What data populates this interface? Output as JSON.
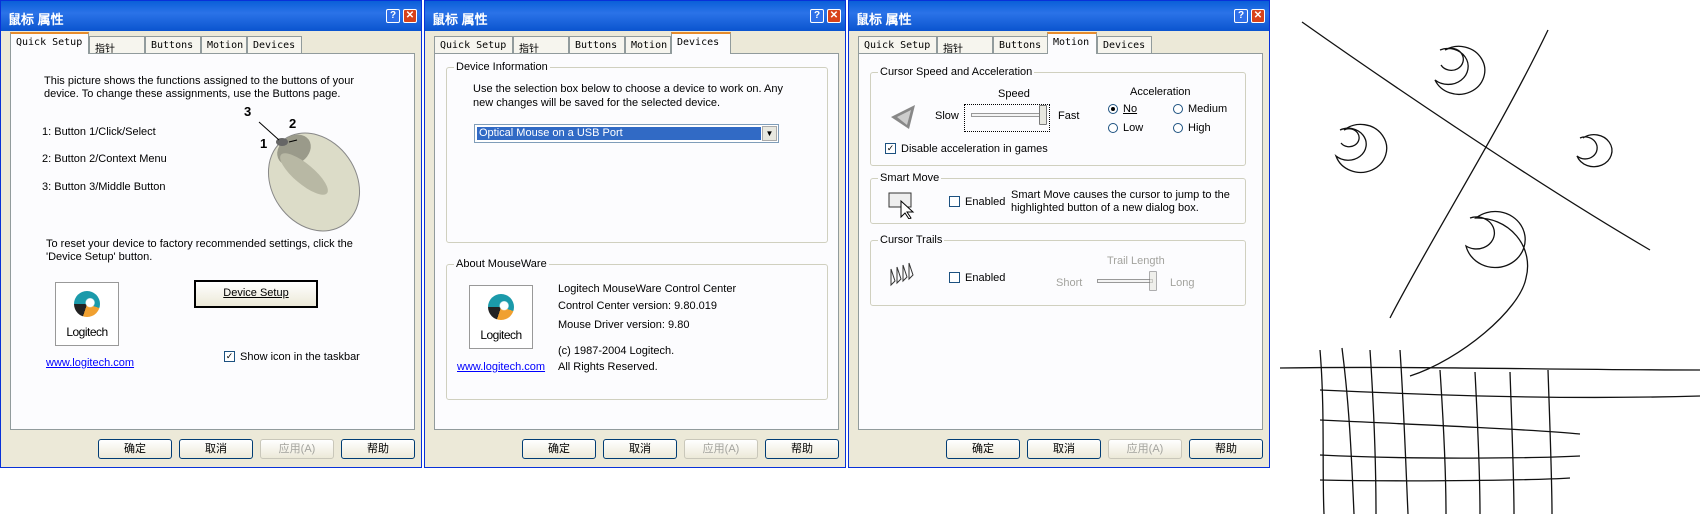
{
  "dialogs": [
    {
      "title": "鼠标 属性",
      "help_glyph": "?",
      "close_glyph": "✕",
      "tabs": [
        "Quick Setup",
        "指针",
        "Buttons",
        "Motion",
        "Devices"
      ],
      "active_tab": "Quick Setup",
      "footer": {
        "ok": "确定",
        "cancel": "取消",
        "apply": "应用(A)",
        "help": "帮助"
      }
    },
    {
      "title": "鼠标 属性",
      "help_glyph": "?",
      "close_glyph": "✕",
      "tabs": [
        "Quick Setup",
        "指针",
        "Buttons",
        "Motion",
        "Devices"
      ],
      "active_tab": "Devices",
      "footer": {
        "ok": "确定",
        "cancel": "取消",
        "apply": "应用(A)",
        "help": "帮助"
      }
    },
    {
      "title": "鼠标 属性",
      "help_glyph": "?",
      "close_glyph": "✕",
      "tabs": [
        "Quick Setup",
        "指针",
        "Buttons",
        "Motion",
        "Devices"
      ],
      "active_tab": "Motion",
      "footer": {
        "ok": "确定",
        "cancel": "取消",
        "apply": "应用(A)",
        "help": "帮助"
      }
    }
  ],
  "quick_setup": {
    "intro": [
      "This picture shows the functions assigned to the buttons of your",
      "device.  To change these assignments, use the Buttons page."
    ],
    "assignments": [
      "1:   Button 1/Click/Select",
      "2:   Button 2/Context Menu",
      "3:   Button 3/Middle Button"
    ],
    "callouts": [
      "1",
      "2",
      "3"
    ],
    "reset_text": [
      "To reset your device to factory recommended settings, click the",
      "'Device Setup' button."
    ],
    "device_setup_button": "Device Setup",
    "logo_text": "Logitech",
    "website": "www.logitech.com",
    "show_icon_label": "Show icon in the taskbar",
    "show_icon_checked": true,
    "check_glyph": "✓"
  },
  "devices": {
    "device_info_title": "Device Information",
    "device_info_text": [
      "Use the selection box below to choose a device to work on. Any",
      "new changes will be saved for the selected device."
    ],
    "selected_device": "Optical Mouse on a USB Port",
    "about_title": "About MouseWare",
    "product_name": "Logitech MouseWare Control Center",
    "control_center_version": "Control Center version:  9.80.019",
    "driver_version": "Mouse Driver version:  9.80",
    "copyright": "(c) 1987-2004 Logitech.",
    "rights": "All Rights Reserved.",
    "logo_text": "Logitech",
    "website": "www.logitech.com"
  },
  "motion": {
    "speed_group_title": "Cursor Speed and Acceleration",
    "speed_label": "Speed",
    "slow_label": "Slow",
    "fast_label": "Fast",
    "speed_value": 1.0,
    "acceleration_label": "Acceleration",
    "accel_options": [
      "No",
      "Medium",
      "Low",
      "High"
    ],
    "accel_selected": "No",
    "disable_accel_label": "Disable acceleration in games",
    "disable_accel_checked": true,
    "check_glyph": "✓",
    "smart_move_title": "Smart Move",
    "smart_move_enabled_label": "Enabled",
    "smart_move_text": [
      "Smart Move causes the cursor to jump to the",
      "highlighted button of a new dialog box."
    ],
    "cursor_trails_title": "Cursor Trails",
    "trails_enabled_label": "Enabled",
    "trail_length_label": "Trail Length",
    "short_label": "Short",
    "long_label": "Long",
    "trail_length_value": 1.0
  }
}
